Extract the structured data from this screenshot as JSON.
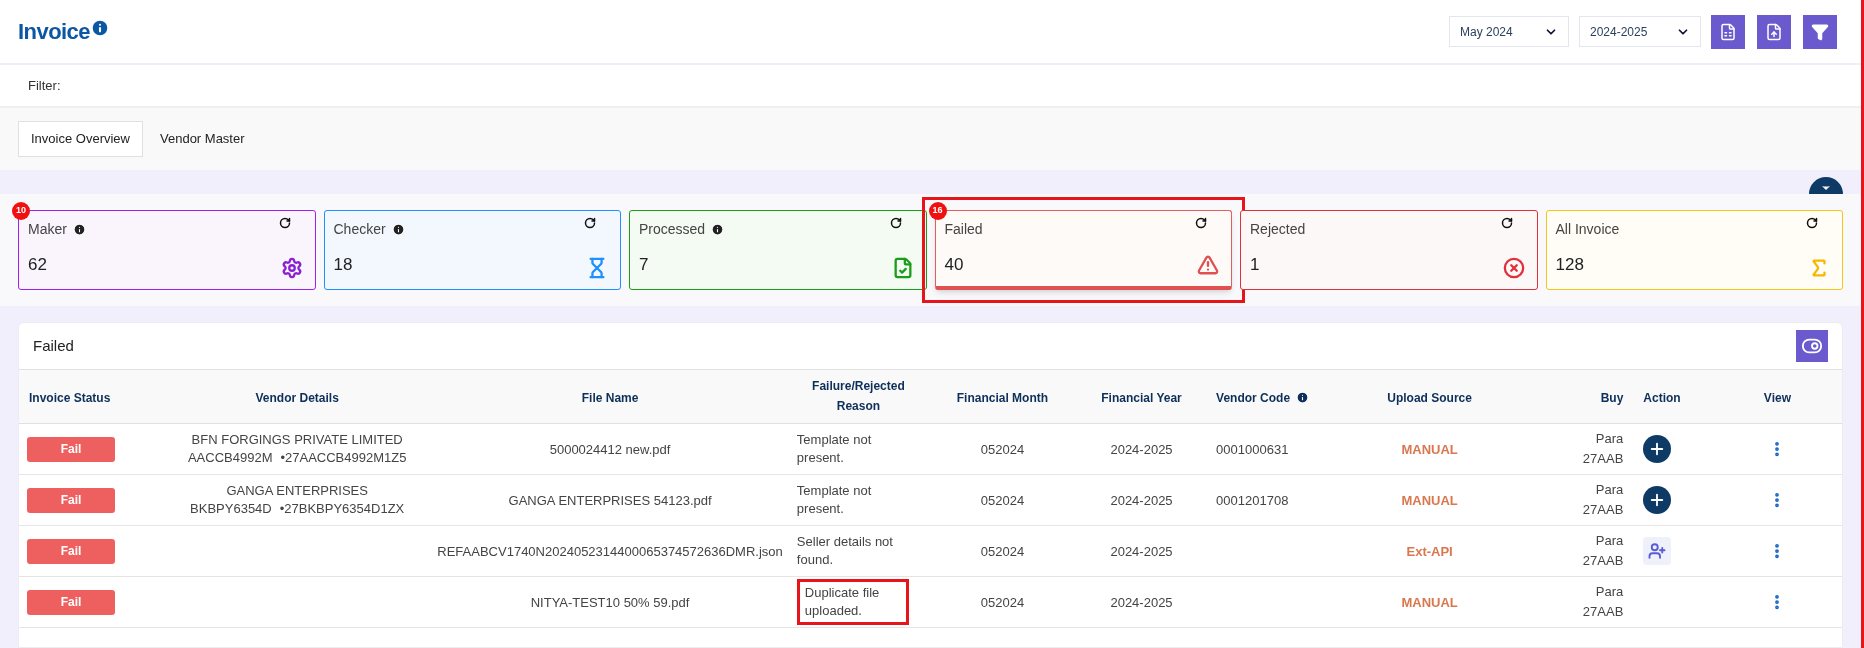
{
  "header": {
    "title": "Invoice",
    "month_select": "May 2024",
    "year_select": "2024-2025"
  },
  "filter": {
    "label": "Filter:"
  },
  "summary_panel": {
    "expanded": true
  },
  "tabs": [
    {
      "label": "Invoice Overview",
      "selected": true
    },
    {
      "label": "Vendor Master",
      "selected": false
    }
  ],
  "cards": [
    {
      "kind": "maker",
      "label": "Maker",
      "count": "62",
      "badge": "10",
      "info": true,
      "selected": false
    },
    {
      "kind": "checker",
      "label": "Checker",
      "count": "18",
      "info": true,
      "selected": false
    },
    {
      "kind": "processed",
      "label": "Processed",
      "count": "7",
      "info": true,
      "selected": false
    },
    {
      "kind": "failed",
      "label": "Failed",
      "count": "40",
      "badge": "16",
      "info": false,
      "selected": true,
      "highlighted": true
    },
    {
      "kind": "rejected",
      "label": "Rejected",
      "count": "1",
      "info": false,
      "selected": false
    },
    {
      "kind": "all",
      "label": "All Invoice",
      "count": "128",
      "info": false,
      "selected": false
    }
  ],
  "table": {
    "title": "Failed",
    "columns": [
      "Invoice Status",
      "Vendor Details",
      "File Name",
      "Failure/Rejected Reason",
      "Financial Month",
      "Financial Year",
      "Vendor Code",
      "Upload Source",
      "Buy",
      "Action",
      "View"
    ],
    "rows": [
      {
        "status": "Fail",
        "vendor_name": "BFN FORGINGS PRIVATE LIMITED",
        "vendor_pan": "AACCB4992M",
        "vendor_gstin": "•27AACCB4992M1Z5",
        "file": "5000024412 new.pdf",
        "reason": "Template not present.",
        "reason_highlighted": false,
        "month": "052024",
        "year": "2024-2025",
        "vendor_code": "0001000631",
        "source": "MANUAL",
        "buyer": [
          "Para",
          "27AAB"
        ],
        "kind": "add"
      },
      {
        "status": "Fail",
        "vendor_name": "GANGA ENTERPRISES",
        "vendor_pan": "BKBPY6354D",
        "vendor_gstin": "•27BKBPY6354D1ZX",
        "file": "GANGA ENTERPRISES 54123.pdf",
        "reason": "Template not present.",
        "reason_highlighted": false,
        "month": "052024",
        "year": "2024-2025",
        "vendor_code": "0001201708",
        "source": "MANUAL",
        "buyer": [
          "Para",
          "27AAB"
        ],
        "kind": "add"
      },
      {
        "status": "Fail",
        "file": "REFAABCV1740N2024052314400065374572636DMR.json",
        "reason": "Seller details not found.",
        "reason_highlighted": false,
        "month": "052024",
        "year": "2024-2025",
        "source": "Ext-API",
        "buyer": [
          "Para",
          "27AAB"
        ],
        "kind": "assign"
      },
      {
        "status": "Fail",
        "file": "NITYA-TEST10 50% 59.pdf",
        "reason": "Duplicate file uploaded.",
        "reason_highlighted": true,
        "month": "052024",
        "year": "2024-2025",
        "source": "MANUAL",
        "buyer": [
          "Para",
          "27AAB"
        ]
      }
    ]
  }
}
